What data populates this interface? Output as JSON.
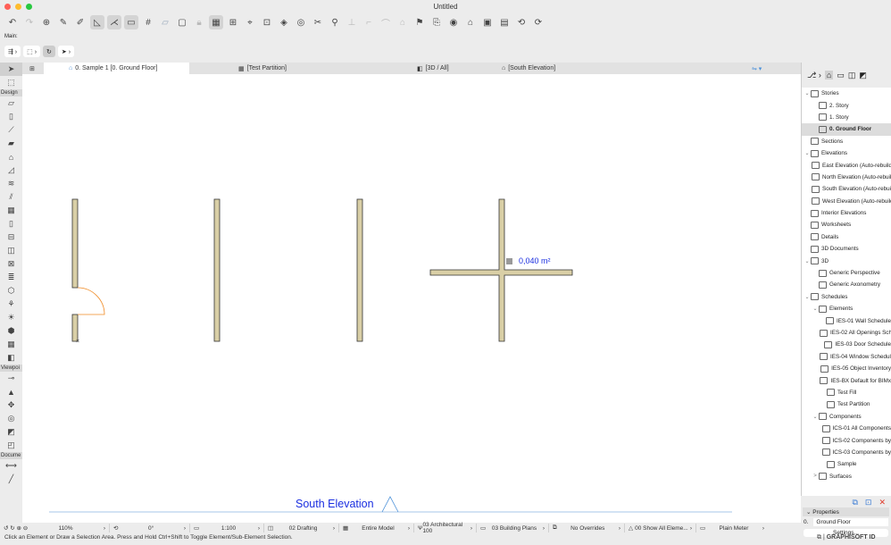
{
  "window": {
    "title": "Untitled"
  },
  "toolbar": {
    "main_label": "Main:"
  },
  "tabs": [
    {
      "label": "0. Sample 1 [0. Ground Floor]"
    },
    {
      "label": "[Test Partition]"
    },
    {
      "label": "[3D / All]"
    },
    {
      "label": "[South Elevation]"
    }
  ],
  "toolbox": {
    "sections": [
      "Design",
      "Viewpoi",
      "Docume"
    ]
  },
  "canvas": {
    "area_label": "0,040 m²",
    "elevation_marker": "South Elevation"
  },
  "navigator": {
    "items": [
      {
        "label": "Stories",
        "level": 0,
        "chev": "v"
      },
      {
        "label": "2. Story",
        "level": 1
      },
      {
        "label": "1. Story",
        "level": 1
      },
      {
        "label": "0. Ground Floor",
        "level": 1,
        "selected": true
      },
      {
        "label": "Sections",
        "level": 0
      },
      {
        "label": "Elevations",
        "level": 0,
        "chev": "v"
      },
      {
        "label": "East Elevation (Auto-rebuild)",
        "level": 1
      },
      {
        "label": "North Elevation (Auto-rebuild)",
        "level": 1
      },
      {
        "label": "South Elevation (Auto-rebuild)",
        "level": 1
      },
      {
        "label": "West Elevation (Auto-rebuild)",
        "level": 1
      },
      {
        "label": "Interior Elevations",
        "level": 0
      },
      {
        "label": "Worksheets",
        "level": 0
      },
      {
        "label": "Details",
        "level": 0
      },
      {
        "label": "3D Documents",
        "level": 0
      },
      {
        "label": "3D",
        "level": 0,
        "chev": "v"
      },
      {
        "label": "Generic Perspective",
        "level": 1
      },
      {
        "label": "Generic Axonometry",
        "level": 1
      },
      {
        "label": "Schedules",
        "level": 0,
        "chev": "v"
      },
      {
        "label": "Elements",
        "level": 1,
        "chev": "v"
      },
      {
        "label": "IES-01 Wall Schedule",
        "level": 2
      },
      {
        "label": "IES-02 All Openings Schedule",
        "level": 2
      },
      {
        "label": "IES-03 Door Schedule",
        "level": 2
      },
      {
        "label": "IES-04 Window Schedule",
        "level": 2
      },
      {
        "label": "IES-05 Object Inventory",
        "level": 2
      },
      {
        "label": "IES-BX Default for BIMx",
        "level": 2
      },
      {
        "label": "Test Fill",
        "level": 2
      },
      {
        "label": "Test Partition",
        "level": 2
      },
      {
        "label": "Components",
        "level": 1,
        "chev": "v"
      },
      {
        "label": "ICS-01 All Components",
        "level": 2
      },
      {
        "label": "ICS-02 Components by",
        "level": 2
      },
      {
        "label": "ICS-03 Components by",
        "level": 2
      },
      {
        "label": "Sample",
        "level": 2
      },
      {
        "label": "Surfaces",
        "level": 1,
        "chev": ">"
      }
    ]
  },
  "properties": {
    "title": "Properties",
    "story_num": "0.",
    "story_name": "Ground Floor",
    "settings_label": "Settings..."
  },
  "statusbar": {
    "zoom": "110%",
    "angle": "0°",
    "scale": "1:100",
    "layer_combo": "02 Drafting",
    "model": "Entire Model",
    "pen_set": "03 Architectural 100",
    "mvo": "03 Building Plans",
    "overrides": "No Overrides",
    "renovation": "00 Show All Eleme...",
    "dimension": "Plain Meter"
  },
  "hint": "Click an Element or Draw a Selection Area. Press and Hold Ctrl+Shift to Toggle Element/Sub-Element Selection.",
  "brand": "GRAPHISOFT ID"
}
